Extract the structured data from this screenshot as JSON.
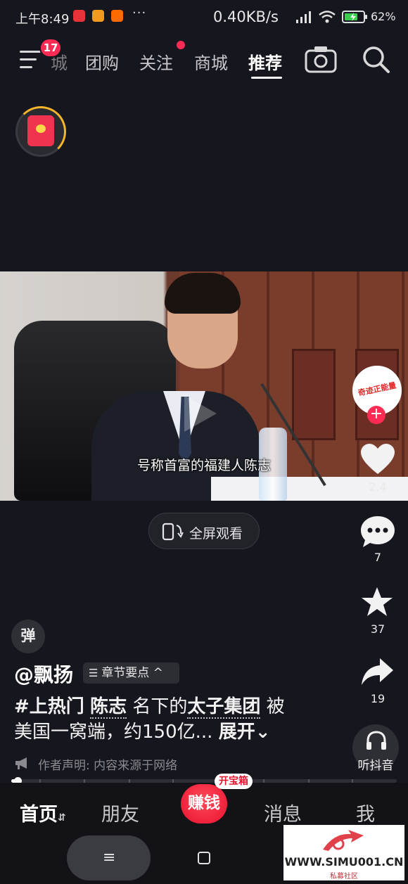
{
  "status_bar": {
    "time": "上午8:49",
    "dots": "···",
    "net_speed": "0.40KB/s",
    "battery": "62%"
  },
  "top_nav": {
    "notification_count": "17",
    "cut_tab": "城",
    "tabs": [
      {
        "label": "团购"
      },
      {
        "label": "关注"
      },
      {
        "label": "商城"
      },
      {
        "label": "推荐"
      }
    ],
    "active_tab": "推荐"
  },
  "video": {
    "subtitle": "号称首富的福建人陈志",
    "fullscreen_label": "全屏观看"
  },
  "actions": {
    "avatar_text": "奇迹正能量",
    "follow": "+",
    "likes": "2.4",
    "comments": "7",
    "favorites": "37",
    "shares": "19",
    "listen_label": "听抖音"
  },
  "danmu": "弹",
  "post": {
    "author": "@飘扬",
    "chapter_chip": "章节要点",
    "desc_line1": {
      "tag": "#上热门",
      "a": "陈志",
      "b": "名下的",
      "c": "太子集团",
      "d": "被"
    },
    "desc_line2": {
      "text": "美国一窝端，约150亿...",
      "more": "展开"
    },
    "disclaimer": "作者声明: 内容来源于网络",
    "progress": 0.01
  },
  "bottom_tabs": {
    "home": "首页",
    "friends": "朋友",
    "earn": "赚钱",
    "treasure": "开宝箱",
    "messages": "消息",
    "me": "我"
  },
  "watermark": {
    "url": "WWW.SIMU001.CN",
    "sub": "私募社区"
  },
  "colors": {
    "accent": "#fe2c55",
    "background": "#16161e"
  }
}
